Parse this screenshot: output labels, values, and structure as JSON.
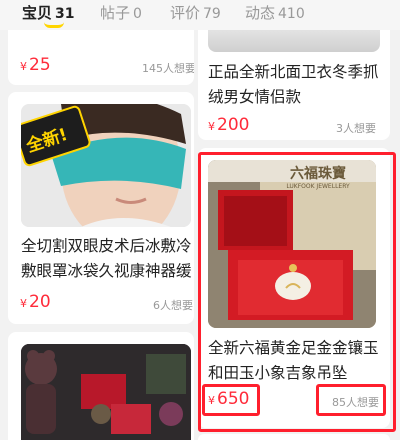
{
  "tabs": [
    {
      "label": "宝贝",
      "count": "31"
    },
    {
      "label": "帖子",
      "count": "0"
    },
    {
      "label": "评价",
      "count": "79"
    },
    {
      "label": "动态",
      "count": "410"
    }
  ],
  "items": [
    {
      "price": "25",
      "want": "145人想要"
    },
    {
      "title": "正品全新北面卫衣冬季抓绒男女情侣款",
      "price": "200",
      "want": "3人想要"
    },
    {
      "title": "全切割双眼皮术后冰敷冷敷眼罩冰袋久视康神器缓",
      "badge": "全新!",
      "price": "20",
      "want": "6人想要"
    },
    {
      "title": "全新六福黄金足金金镶玉和田玉小象吉象吊坠",
      "brand": "六福珠寶",
      "brand_en": "LUKFOOK JEWELLERY",
      "price": "650",
      "want": "85人想要"
    }
  ],
  "currency_symbol": "¥",
  "colors": {
    "price": "#ff2b3a",
    "highlight": "#ff1f2d",
    "tab_underline": "#ffd500"
  }
}
